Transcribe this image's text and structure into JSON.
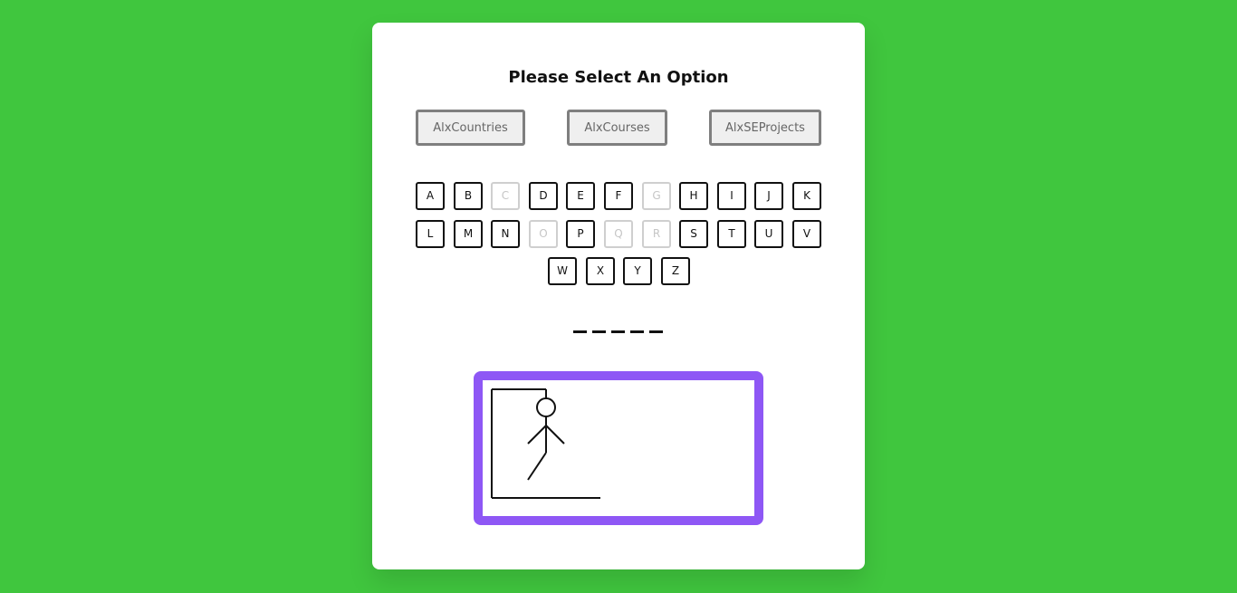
{
  "title": "Please Select An Option",
  "options": [
    {
      "label": "AlxCountries"
    },
    {
      "label": "AlxCourses"
    },
    {
      "label": "AlxSEProjects"
    }
  ],
  "keyboard": {
    "letters": [
      "A",
      "B",
      "C",
      "D",
      "E",
      "F",
      "G",
      "H",
      "I",
      "J",
      "K",
      "L",
      "M",
      "N",
      "O",
      "P",
      "Q",
      "R",
      "S",
      "T",
      "U",
      "V",
      "W",
      "X",
      "Y",
      "Z"
    ],
    "used_letters": [
      "C",
      "G",
      "O",
      "Q",
      "R"
    ]
  },
  "word": {
    "blank_count": 5
  },
  "hangman": {
    "parts_shown": [
      "head",
      "body",
      "left-arm",
      "right-arm",
      "left-leg"
    ],
    "frame_color": "#8e57f5"
  },
  "colors": {
    "background": "#40c63e",
    "card": "#ffffff"
  }
}
